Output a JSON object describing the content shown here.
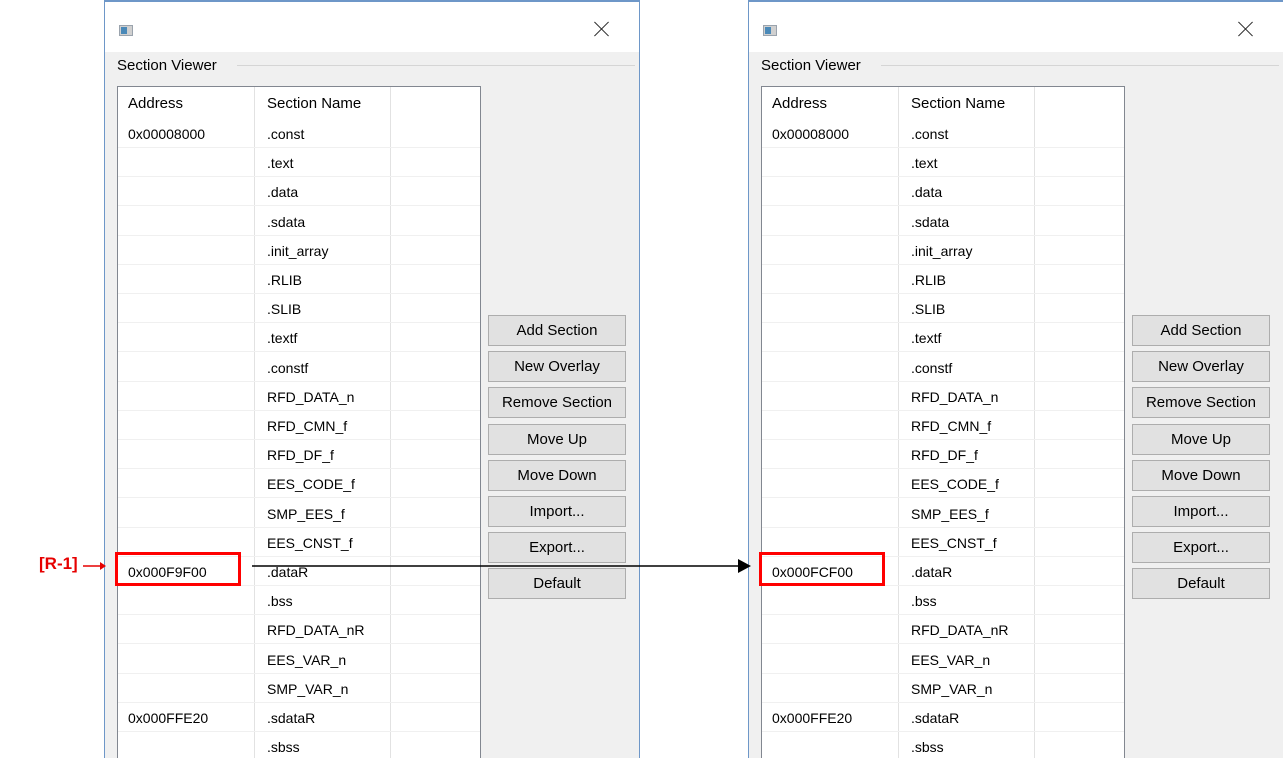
{
  "dialogs": [
    {
      "group_label": "Section Viewer",
      "columns": [
        "Address",
        "Section Name"
      ],
      "rows": [
        {
          "address": "0x00008000",
          "name": ".const"
        },
        {
          "address": "",
          "name": ".text"
        },
        {
          "address": "",
          "name": ".data"
        },
        {
          "address": "",
          "name": ".sdata"
        },
        {
          "address": "",
          "name": ".init_array"
        },
        {
          "address": "",
          "name": ".RLIB"
        },
        {
          "address": "",
          "name": ".SLIB"
        },
        {
          "address": "",
          "name": ".textf"
        },
        {
          "address": "",
          "name": ".constf"
        },
        {
          "address": "",
          "name": "RFD_DATA_n"
        },
        {
          "address": "",
          "name": "RFD_CMN_f"
        },
        {
          "address": "",
          "name": "RFD_DF_f"
        },
        {
          "address": "",
          "name": "EES_CODE_f"
        },
        {
          "address": "",
          "name": "SMP_EES_f"
        },
        {
          "address": "",
          "name": "EES_CNST_f"
        },
        {
          "address": "0x000F9F00",
          "name": ".dataR"
        },
        {
          "address": "",
          "name": ".bss"
        },
        {
          "address": "",
          "name": "RFD_DATA_nR"
        },
        {
          "address": "",
          "name": "EES_VAR_n"
        },
        {
          "address": "",
          "name": "SMP_VAR_n"
        },
        {
          "address": "0x000FFE20",
          "name": ".sdataR"
        },
        {
          "address": "",
          "name": ".sbss"
        }
      ],
      "highlighted_row": 15,
      "buttons": [
        "Add Section",
        "New Overlay",
        "Remove Section",
        "Move Up",
        "Move Down",
        "Import...",
        "Export...",
        "Default"
      ]
    },
    {
      "group_label": "Section Viewer",
      "columns": [
        "Address",
        "Section Name"
      ],
      "rows": [
        {
          "address": "0x00008000",
          "name": ".const"
        },
        {
          "address": "",
          "name": ".text"
        },
        {
          "address": "",
          "name": ".data"
        },
        {
          "address": "",
          "name": ".sdata"
        },
        {
          "address": "",
          "name": ".init_array"
        },
        {
          "address": "",
          "name": ".RLIB"
        },
        {
          "address": "",
          "name": ".SLIB"
        },
        {
          "address": "",
          "name": ".textf"
        },
        {
          "address": "",
          "name": ".constf"
        },
        {
          "address": "",
          "name": "RFD_DATA_n"
        },
        {
          "address": "",
          "name": "RFD_CMN_f"
        },
        {
          "address": "",
          "name": "RFD_DF_f"
        },
        {
          "address": "",
          "name": "EES_CODE_f"
        },
        {
          "address": "",
          "name": "SMP_EES_f"
        },
        {
          "address": "",
          "name": "EES_CNST_f"
        },
        {
          "address": "0x000FCF00",
          "name": ".dataR"
        },
        {
          "address": "",
          "name": ".bss"
        },
        {
          "address": "",
          "name": "RFD_DATA_nR"
        },
        {
          "address": "",
          "name": "EES_VAR_n"
        },
        {
          "address": "",
          "name": "SMP_VAR_n"
        },
        {
          "address": "0x000FFE20",
          "name": ".sdataR"
        },
        {
          "address": "",
          "name": ".sbss"
        }
      ],
      "highlighted_row": 15,
      "buttons": [
        "Add Section",
        "New Overlay",
        "Remove Section",
        "Move Up",
        "Move Down",
        "Import...",
        "Export...",
        "Default"
      ]
    }
  ],
  "annotation": {
    "label": "[R-1]",
    "arrow_glyph": "→",
    "color": "#e60000"
  }
}
